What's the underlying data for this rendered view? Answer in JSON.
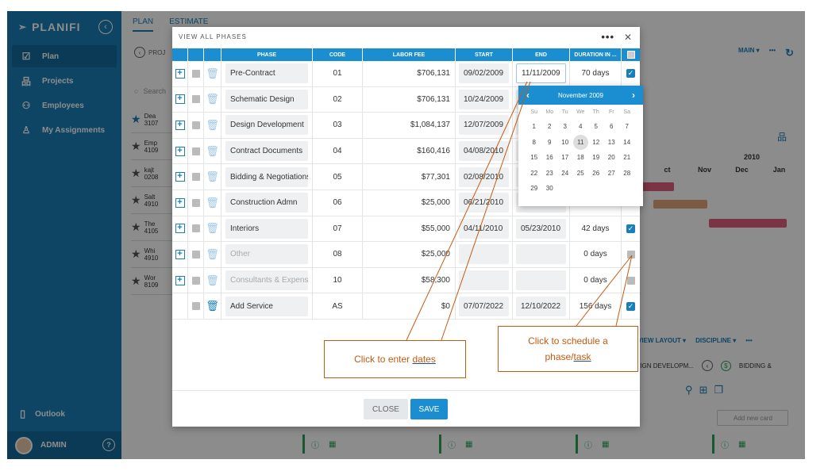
{
  "app": {
    "name": "PLANIFI"
  },
  "sidebar": {
    "items": [
      {
        "label": "Plan",
        "icon": "calendar-icon",
        "active": true
      },
      {
        "label": "Projects",
        "icon": "org-chart-icon",
        "active": false
      },
      {
        "label": "Employees",
        "icon": "people-icon",
        "active": false
      },
      {
        "label": "My Assignments",
        "icon": "person-icon",
        "active": false
      }
    ],
    "outlook": "Outlook",
    "user": "ADMIN"
  },
  "background": {
    "tabs": [
      "PLAN",
      "ESTIMATE"
    ],
    "project_prefix": "PROJ",
    "search_placeholder": "Search",
    "list": [
      {
        "name": "Dea",
        "code": "3107"
      },
      {
        "name": "Emp",
        "code": "4109"
      },
      {
        "name": "kajt",
        "code": "0208"
      },
      {
        "name": "Salt",
        "code": "4910"
      },
      {
        "name": "The",
        "code": "4105"
      },
      {
        "name": "Whi",
        "code": "4910"
      },
      {
        "name": "Wor",
        "code": "8109"
      }
    ],
    "top_menu": "MAIN",
    "year": "2010",
    "months": [
      "ct",
      "Nov",
      "Dec",
      "Jan",
      "F"
    ],
    "layout_menu": "VIEW LAYOUT",
    "discipline_menu": "DISCIPLINE",
    "crumb_1": "SIGN DEVELOPM...",
    "crumb_2": "BIDDING &",
    "add_card": "Add new card"
  },
  "modal": {
    "title": "VIEW ALL PHASES",
    "columns": [
      "PHASE",
      "CODE",
      "LABOR FEE",
      "START",
      "END",
      "DURATION IN ..."
    ],
    "rows": [
      {
        "phase": "Pre-Contract",
        "code": "01",
        "fee": "$706,131",
        "start": "09/02/2009",
        "end": "11/11/2009",
        "duration": "70 days",
        "scheduled": true,
        "muted": false,
        "expand": true,
        "end_active": true
      },
      {
        "phase": "Schematic Design",
        "code": "02",
        "fee": "$706,131",
        "start": "10/24/2009",
        "end": "",
        "duration": "",
        "scheduled": null,
        "muted": false,
        "expand": true
      },
      {
        "phase": "Design Development",
        "code": "03",
        "fee": "$1,084,137",
        "start": "12/07/2009",
        "end": "",
        "duration": "",
        "scheduled": null,
        "muted": false,
        "expand": true
      },
      {
        "phase": "Contract Documents",
        "code": "04",
        "fee": "$160,416",
        "start": "04/08/2010",
        "end": "",
        "duration": "",
        "scheduled": null,
        "muted": false,
        "expand": true
      },
      {
        "phase": "Bidding & Negotiations",
        "code": "05",
        "fee": "$77,301",
        "start": "02/08/2010",
        "end": "",
        "duration": "",
        "scheduled": null,
        "muted": false,
        "expand": true
      },
      {
        "phase": "Construction Admn",
        "code": "06",
        "fee": "$25,000",
        "start": "06/21/2010",
        "end": "",
        "duration": "",
        "scheduled": null,
        "muted": false,
        "expand": true
      },
      {
        "phase": "Interiors",
        "code": "07",
        "fee": "$55,000",
        "start": "04/11/2010",
        "end": "05/23/2010",
        "duration": "42 days",
        "scheduled": true,
        "muted": false,
        "expand": true
      },
      {
        "phase": "Other",
        "code": "08",
        "fee": "$25,000",
        "start": "",
        "end": "",
        "duration": "0 days",
        "scheduled": false,
        "muted": true,
        "expand": true
      },
      {
        "phase": "Consultants & Expenses",
        "code": "10",
        "fee": "$58,300",
        "start": "",
        "end": "",
        "duration": "0 days",
        "scheduled": false,
        "muted": true,
        "expand": true
      },
      {
        "phase": "Add Service",
        "code": "AS",
        "fee": "$0",
        "start": "07/07/2022",
        "end": "12/10/2022",
        "duration": "156 days",
        "scheduled": true,
        "muted": false,
        "expand": false
      }
    ],
    "close_label": "CLOSE",
    "save_label": "SAVE"
  },
  "calendar": {
    "month": "November 2009",
    "dow": [
      "Su",
      "Mo",
      "Tu",
      "We",
      "Th",
      "Fr",
      "Sa"
    ],
    "weeks": [
      [
        "1",
        "2",
        "3",
        "4",
        "5",
        "6",
        "7"
      ],
      [
        "8",
        "9",
        "10",
        "11",
        "12",
        "13",
        "14"
      ],
      [
        "15",
        "16",
        "17",
        "18",
        "19",
        "20",
        "21"
      ],
      [
        "22",
        "23",
        "24",
        "25",
        "26",
        "27",
        "28"
      ],
      [
        "29",
        "30",
        "",
        "",
        "",
        "",
        ""
      ]
    ],
    "selected": "11"
  },
  "callouts": {
    "dates_prefix": "Click to enter ",
    "dates_link": "dates",
    "schedule_line1": "Click to schedule a",
    "schedule_prefix": "phase/",
    "schedule_link": "task"
  },
  "colors": {
    "brand": "#1a7fb8",
    "header": "#1a8ed0",
    "callout": "#c55a11"
  }
}
